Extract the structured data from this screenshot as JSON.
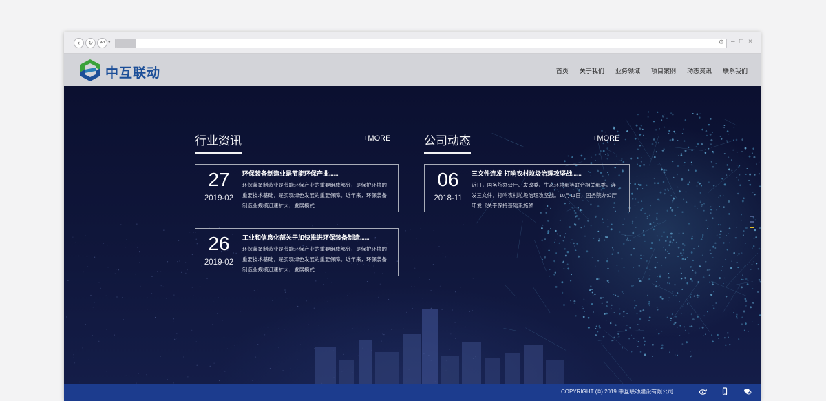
{
  "nav": {
    "items": [
      {
        "label": "首页"
      },
      {
        "label": "关于我们"
      },
      {
        "label": "业务领域"
      },
      {
        "label": "项目案例"
      },
      {
        "label": "动态资讯"
      },
      {
        "label": "联系我们"
      }
    ]
  },
  "logo": {
    "text": "中互联动",
    "colors": {
      "green": "#3aa23a",
      "blue": "#1b4e98"
    }
  },
  "industry_news": {
    "title": "行业资讯",
    "more_label": "+MORE",
    "items": [
      {
        "day": "27",
        "year_month": "2019-02",
        "title": "环保装备制造业是节能环保产业......",
        "desc_lines": [
          "环保装备制造业是节能环保产业的重要组成部分，是保护环境的",
          "重要技术基础，是实现绿色发展的重要保障。近年来，环保装备",
          "制造业规模迅速扩大，发展模式......"
        ]
      },
      {
        "day": "26",
        "year_month": "2019-02",
        "title": "工业和信息化部关于加快推进环保装备制造......",
        "desc_lines": [
          "环保装备制造业是节能环保产业的重要组成部分，是保护环境的",
          "重要技术基础，是实现绿色发展的重要保障。近年来，环保装备",
          "制造业规模迅速扩大，发展模式......"
        ]
      }
    ]
  },
  "company_news": {
    "title": "公司动态",
    "more_label": "+MORE",
    "items": [
      {
        "day": "06",
        "year_month": "2018-11",
        "title": "三文件连发 打响农村垃圾治理攻坚战......",
        "desc_lines": [
          "近日，国务院办公厅、发改委、生态环境部等联合相关部委，连",
          "发三文件，打响农村垃圾治理攻坚战。10月11日，国务院办公厅",
          "印发《关于保持基础设施领......"
        ]
      }
    ]
  },
  "footer": {
    "copyright": "COPYRIGHT (©) 2019 中互联动建设有限公司",
    "icons": [
      "weibo-icon",
      "mobile-icon",
      "chat-icon"
    ]
  },
  "colors": {
    "hero_bg": "#0d1233",
    "header_bg": "#d3d4d9",
    "footer_bg": "#1c3c8e",
    "indicator_active": "#e6c229"
  }
}
